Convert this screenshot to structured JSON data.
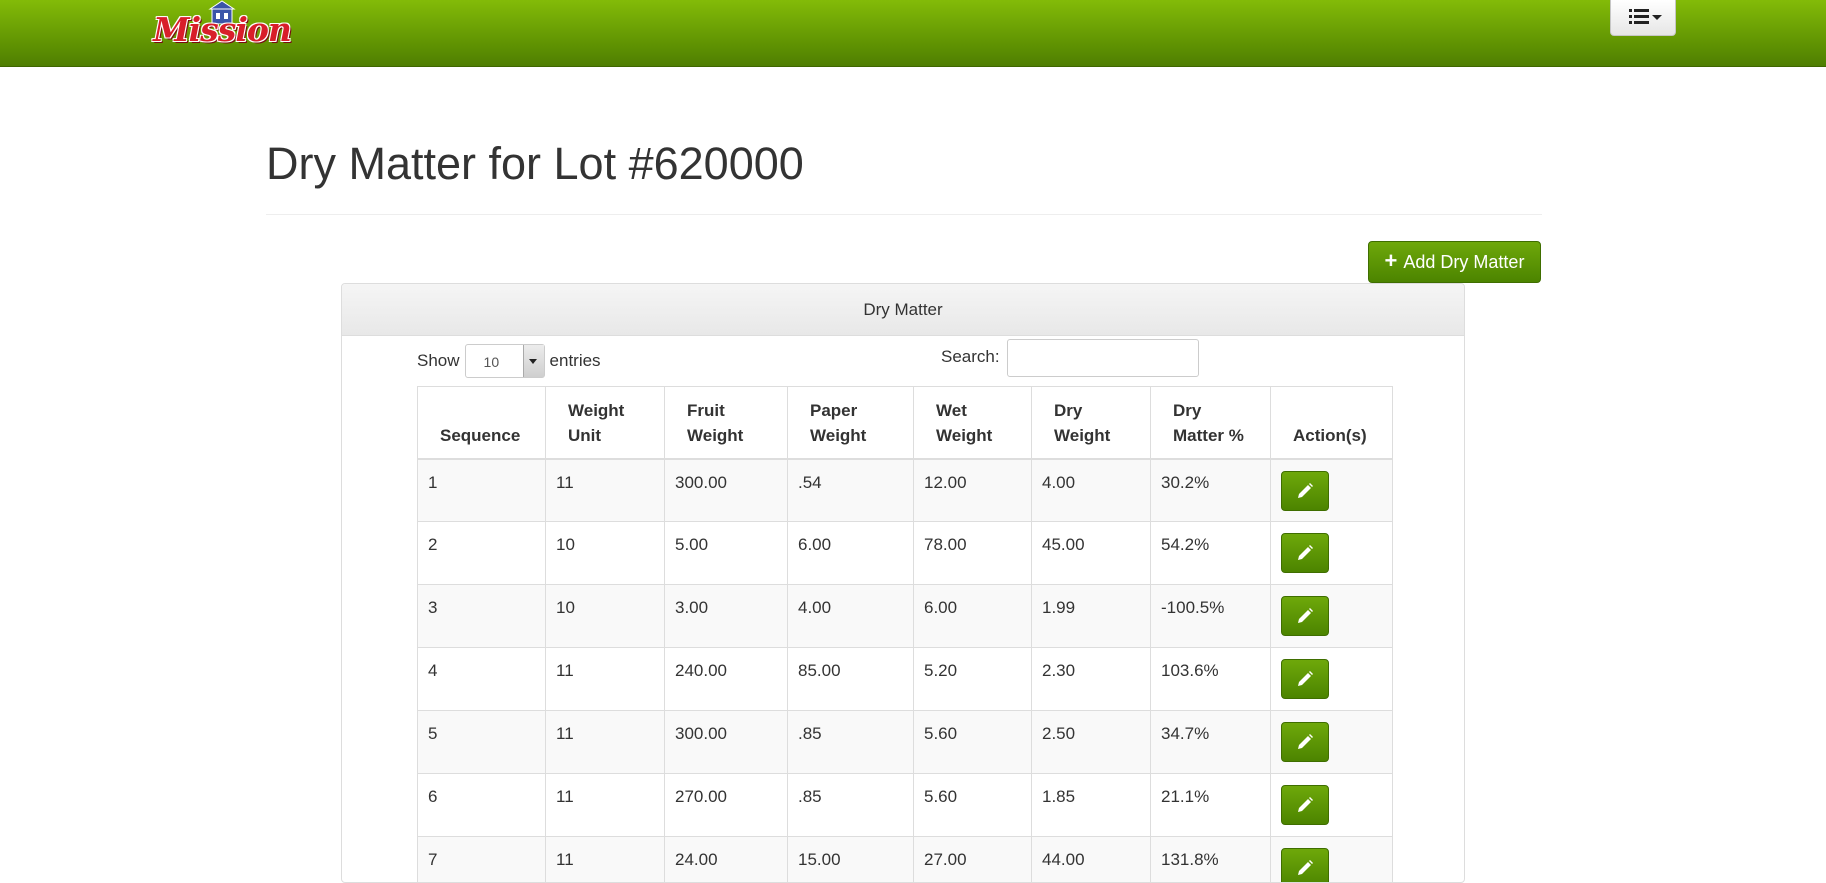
{
  "header": {
    "logo_text": "Mission",
    "menu_icon": "list-icon"
  },
  "page": {
    "title": "Dry Matter for Lot #620000",
    "add_button_label": "Add Dry Matter"
  },
  "panel": {
    "heading": "Dry Matter",
    "show_label": "Show",
    "entries_value": "10",
    "entries_label": "entries",
    "search_label": "Search:",
    "search_value": ""
  },
  "table": {
    "columns": [
      [
        "Sequence"
      ],
      [
        "Weight",
        "Unit"
      ],
      [
        "Fruit",
        "Weight"
      ],
      [
        "Paper",
        "Weight"
      ],
      [
        "Wet",
        "Weight"
      ],
      [
        "Dry",
        "Weight"
      ],
      [
        "Dry",
        "Matter %"
      ],
      [
        "Action(s)"
      ]
    ],
    "rows": [
      [
        "1",
        "11",
        "300.00",
        ".54",
        "12.00",
        "4.00",
        "30.2%"
      ],
      [
        "2",
        "10",
        "5.00",
        "6.00",
        "78.00",
        "45.00",
        "54.2%"
      ],
      [
        "3",
        "10",
        "3.00",
        "4.00",
        "6.00",
        "1.99",
        "-100.5%"
      ],
      [
        "4",
        "11",
        "240.00",
        "85.00",
        "5.20",
        "2.30",
        "103.6%"
      ],
      [
        "5",
        "11",
        "300.00",
        ".85",
        "5.60",
        "2.50",
        "34.7%"
      ],
      [
        "6",
        "11",
        "270.00",
        ".85",
        "5.60",
        "1.85",
        "21.1%"
      ],
      [
        "7",
        "11",
        "24.00",
        "15.00",
        "27.00",
        "44.00",
        "131.8%"
      ]
    ]
  },
  "colors": {
    "brand_green": "#5e9102",
    "button_green": "#4c8400",
    "logo_red": "#d81e2a"
  }
}
